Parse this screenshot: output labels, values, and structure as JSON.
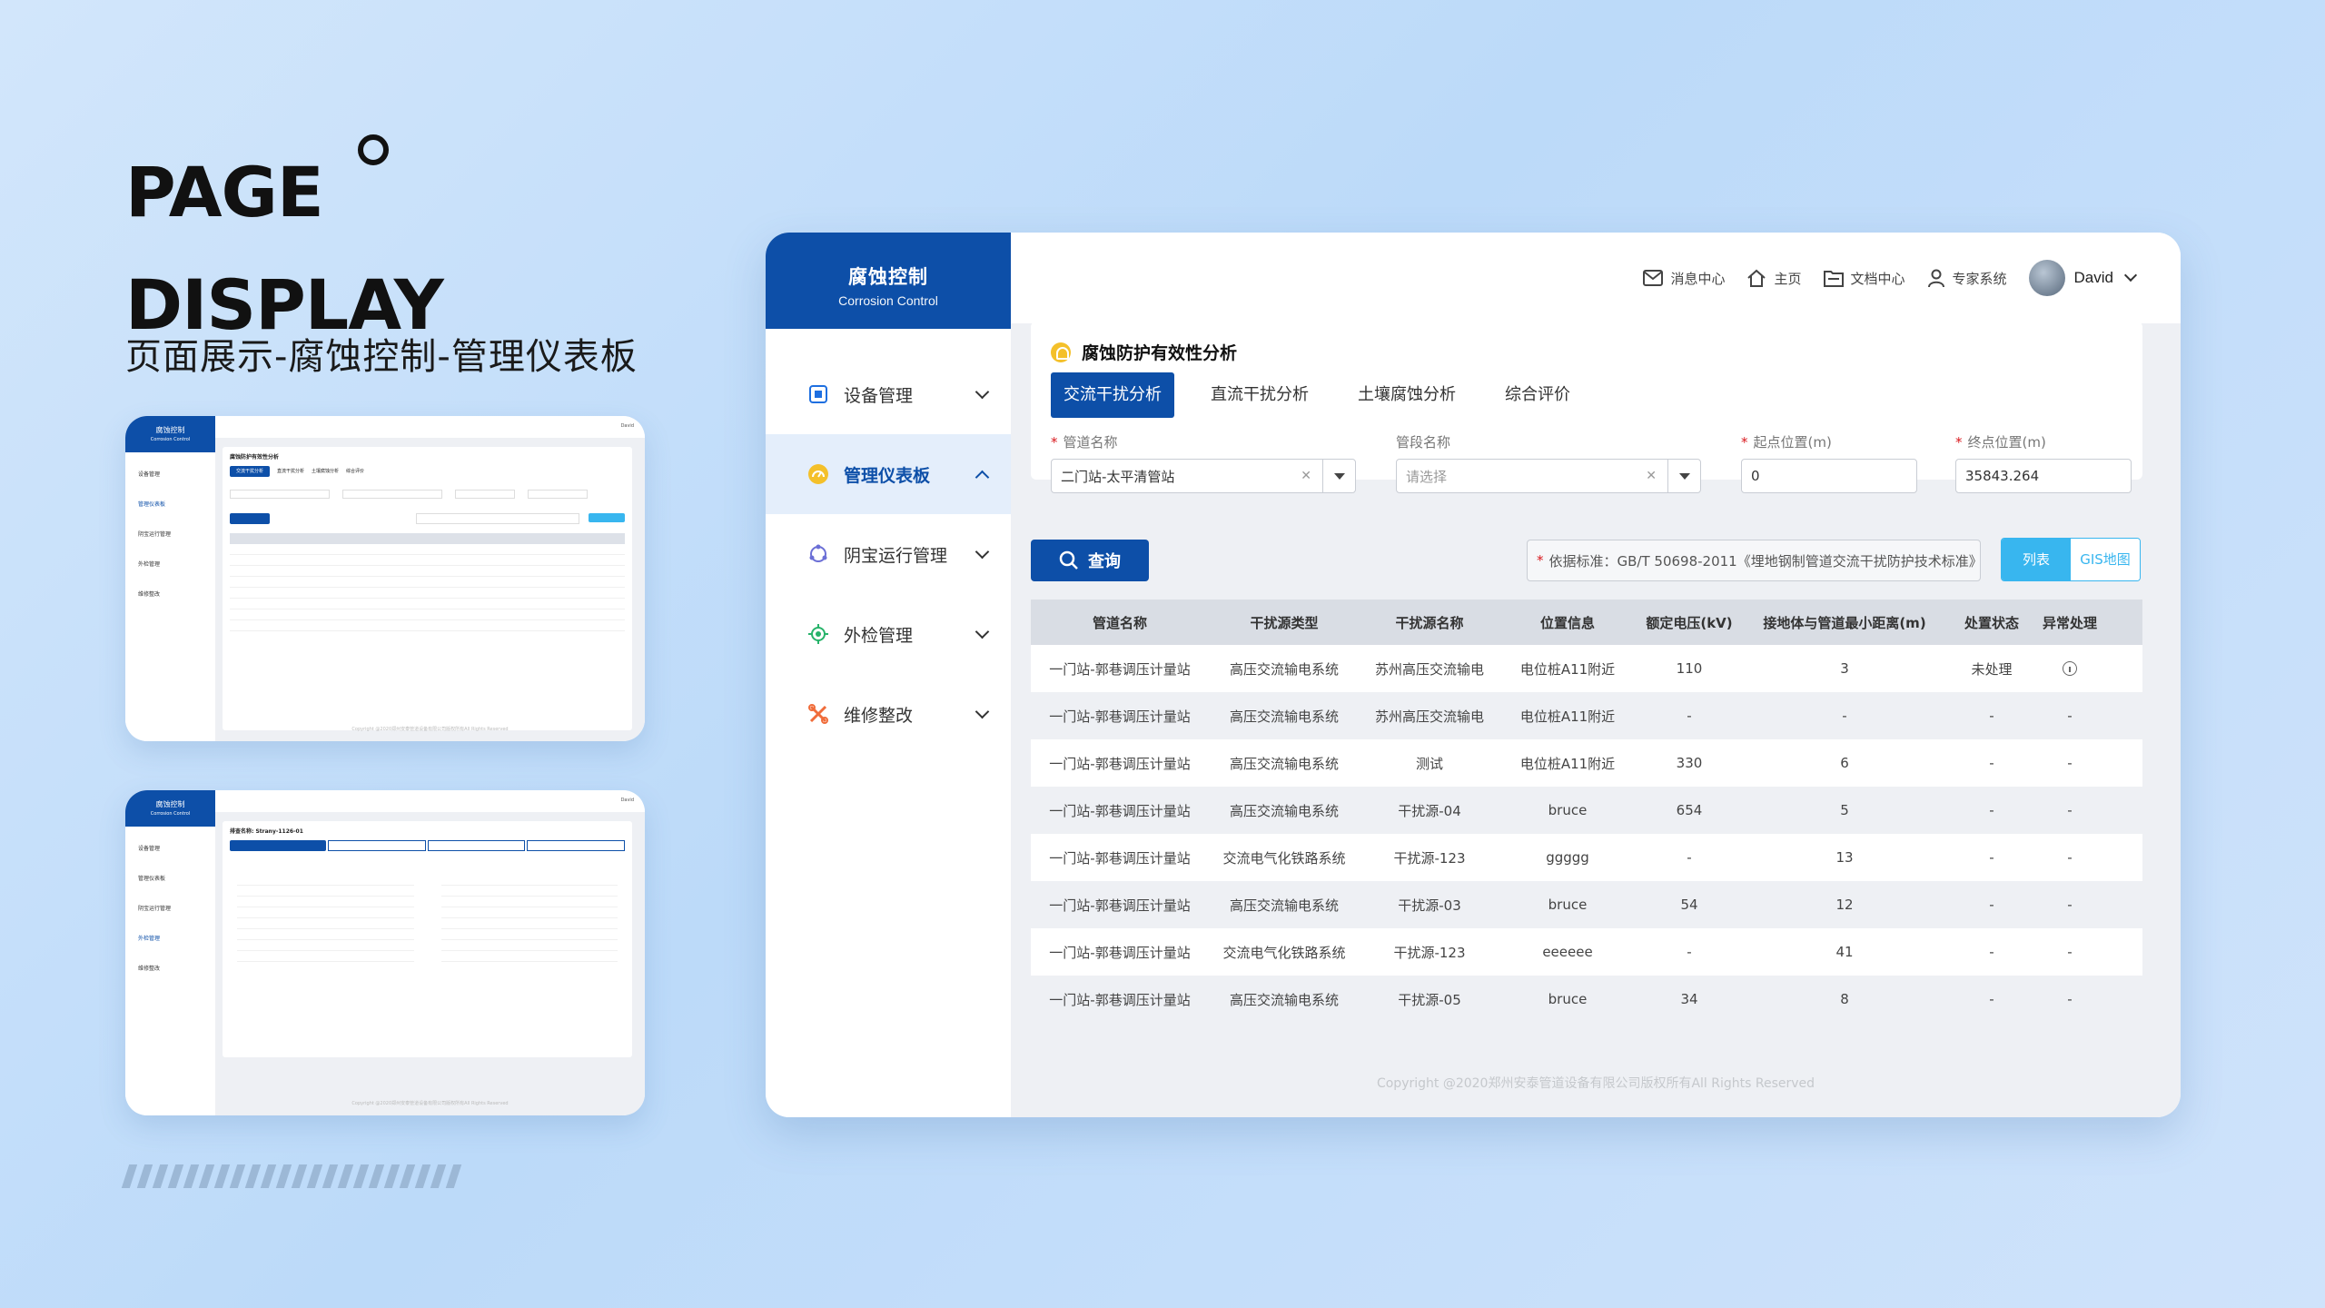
{
  "hero": {
    "line1": "PAGE",
    "line2": "DISPLAY",
    "subtitle": "页面展示-腐蚀控制-管理仪表板"
  },
  "app": {
    "title": "腐蚀控制",
    "subtitle": "Corrosion Control"
  },
  "sidebar": {
    "items": [
      {
        "label": "设备管理",
        "icon": "device-icon",
        "color": "#1e6fe0"
      },
      {
        "label": "管理仪表板",
        "icon": "dashboard-icon",
        "color": "#f4c02a",
        "active": true
      },
      {
        "label": "阴宝运行管理",
        "icon": "cycle-icon",
        "color": "#6b6fd6"
      },
      {
        "label": "外检管理",
        "icon": "target-icon",
        "color": "#27b36a"
      },
      {
        "label": "维修整改",
        "icon": "tools-icon",
        "color": "#f06c3a"
      }
    ]
  },
  "topbar": {
    "messages": "消息中心",
    "home": "主页",
    "docs": "文档中心",
    "expert": "专家系统",
    "user": "David"
  },
  "panel": {
    "title": "腐蚀防护有效性分析",
    "tabs": [
      "交流干扰分析",
      "直流干扰分析",
      "土壤腐蚀分析",
      "综合评价"
    ]
  },
  "filters": {
    "pipeline_label": "管道名称",
    "pipeline_value": "二门站-太平清管站",
    "segment_label": "管段名称",
    "segment_placeholder": "请选择",
    "start_label": "起点位置(m)",
    "start_value": "0",
    "end_label": "终点位置(m)",
    "end_value": "35843.264"
  },
  "actions": {
    "query": "查询",
    "standard": "依据标准：GB/T 50698-2011《埋地钢制管道交流干扰防护技术标准》",
    "list": "列表",
    "gis": "GIS地图"
  },
  "table": {
    "headers": [
      "管道名称",
      "干扰源类型",
      "干扰源名称",
      "位置信息",
      "额定电压(kV)",
      "接地体与管道最小距离(m)",
      "处置状态",
      "异常处理"
    ],
    "rows": [
      [
        "一门站-郭巷调压计量站",
        "高压交流输电系统",
        "苏州高压交流输电",
        "电位桩A11附近",
        "110",
        "3",
        "未处理",
        "info"
      ],
      [
        "一门站-郭巷调压计量站",
        "高压交流输电系统",
        "苏州高压交流输电",
        "电位桩A11附近",
        "-",
        "-",
        "-",
        "-"
      ],
      [
        "一门站-郭巷调压计量站",
        "高压交流输电系统",
        "测试",
        "电位桩A11附近",
        "330",
        "6",
        "-",
        "-"
      ],
      [
        "一门站-郭巷调压计量站",
        "高压交流输电系统",
        "干扰源-04",
        "bruce",
        "654",
        "5",
        "-",
        "-"
      ],
      [
        "一门站-郭巷调压计量站",
        "交流电气化铁路系统",
        "干扰源-123",
        "ggggg",
        "-",
        "13",
        "-",
        "-"
      ],
      [
        "一门站-郭巷调压计量站",
        "高压交流输电系统",
        "干扰源-03",
        "bruce",
        "54",
        "12",
        "-",
        "-"
      ],
      [
        "一门站-郭巷调压计量站",
        "交流电气化铁路系统",
        "干扰源-123",
        "eeeeee",
        "-",
        "41",
        "-",
        "-"
      ],
      [
        "一门站-郭巷调压计量站",
        "高压交流输电系统",
        "干扰源-05",
        "bruce",
        "34",
        "8",
        "-",
        "-"
      ]
    ]
  },
  "copyright": "Copyright @2020郑州安泰管道设备有限公司版权所有All Rights Reserved",
  "thumb2": {
    "title": "排查名称: Strany-1126-01"
  },
  "colors": {
    "primary": "#0d4fa8",
    "accent": "#38b6ef",
    "danger": "#d9191e"
  }
}
